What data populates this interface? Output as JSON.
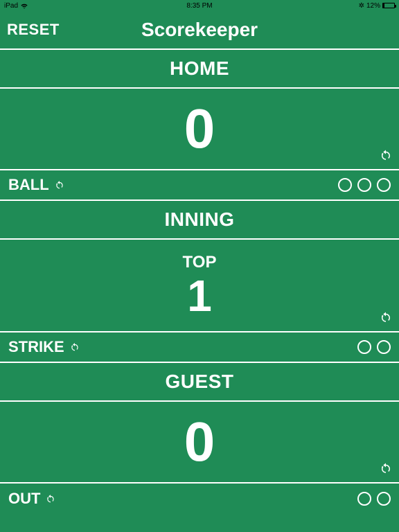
{
  "statusbar": {
    "device": "iPad",
    "time": "8:35 PM",
    "bluetooth": "✲",
    "battery_pct": "12%"
  },
  "header": {
    "reset_label": "RESET",
    "title": "Scorekeeper"
  },
  "home": {
    "label": "HOME",
    "score": "0"
  },
  "ball": {
    "label": "BALL",
    "count": 0,
    "max": 3
  },
  "inning": {
    "label": "INNING",
    "half": "TOP",
    "number": "1"
  },
  "strike": {
    "label": "STRIKE",
    "count": 0,
    "max": 2
  },
  "guest": {
    "label": "GUEST",
    "score": "0"
  },
  "out": {
    "label": "OUT",
    "count": 0,
    "max": 2
  }
}
